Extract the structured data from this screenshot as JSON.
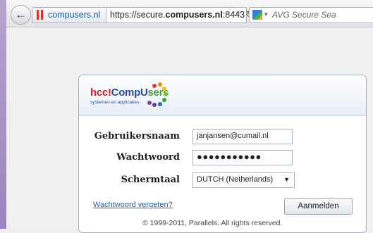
{
  "browser": {
    "back_icon": "back-arrow-icon",
    "identity_label": "compusers.nl",
    "url_prefix": "https://secure.",
    "url_domain": "compusers.nl",
    "url_suffix": ":8443",
    "search_placeholder": "AVG Secure Sea"
  },
  "logo": {
    "text_red": "hcc!",
    "text_blue": "CompU",
    "text_green": "sers",
    "tagline": "systemen en applicaties"
  },
  "form": {
    "username_label": "Gebruikersnaam",
    "username_value": "janjansen@cumail.nl",
    "password_label": "Wachtwoord",
    "password_value": "●●●●●●●●●●●",
    "language_label": "Schermtaal",
    "language_value": "DUTCH (Netherlands)",
    "forgot_link": "Wachtwoord vergeten?",
    "login_button": "Aanmelden"
  },
  "footer": {
    "copyright": "© 1999-2011, Parallels. All rights reserved."
  }
}
